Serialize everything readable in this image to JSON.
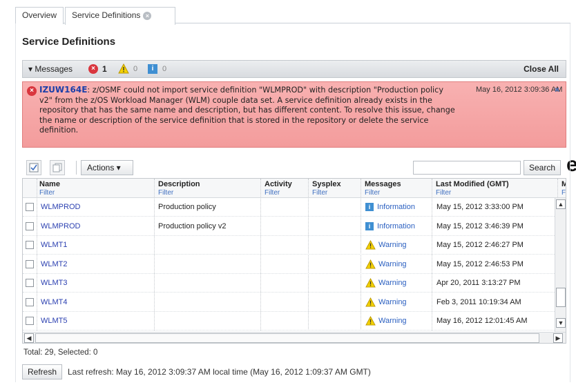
{
  "tabs": [
    {
      "label": "Overview"
    },
    {
      "label": "Service Definitions"
    }
  ],
  "page_title": "Service Definitions",
  "stray_text": "e",
  "messages_bar": {
    "toggle_label": "▾ Messages",
    "error_count": "1",
    "warning_count": "0",
    "info_count": "0",
    "close_all": "Close All"
  },
  "error_message": {
    "code": "IZUW164E",
    "text": ": z/OSMF could not import service definition \"WLMPROD\" with description \"Production policy v2\" from the z/OS Workload Manager (WLM) couple data set. A service definition already exists in the repository that has the same name and description, but has different content. To resolve this issue, change the name or description of the service definition that is stored in the repository or delete the service definition.",
    "date": "May 16, 2012 3:09:36 AM",
    "close": "×"
  },
  "toolbar": {
    "actions_label": "Actions ▾",
    "search_value": "",
    "search_button": "Search"
  },
  "table": {
    "columns": [
      {
        "label": "Name",
        "filter": "Filter"
      },
      {
        "label": "Description",
        "filter": "Filter"
      },
      {
        "label": "Activity",
        "filter": "Filter"
      },
      {
        "label": "Sysplex",
        "filter": "Filter"
      },
      {
        "label": "Messages",
        "filter": "Filter"
      },
      {
        "label": "Last Modified (GMT)",
        "filter": "Filter"
      },
      {
        "label": "M",
        "filter": "F"
      }
    ],
    "rows": [
      {
        "name": "WLMPROD",
        "description": "Production policy",
        "message": "Information",
        "message_type": "info",
        "modified": "May 15, 2012 3:33:00 PM"
      },
      {
        "name": "WLMPROD",
        "description": "Production policy v2",
        "message": "Information",
        "message_type": "info",
        "modified": "May 15, 2012 3:46:39 PM"
      },
      {
        "name": "WLMT1",
        "description": "",
        "message": "Warning",
        "message_type": "warning",
        "modified": "May 15, 2012 2:46:27 PM"
      },
      {
        "name": "WLMT2",
        "description": "",
        "message": "Warning",
        "message_type": "warning",
        "modified": "May 15, 2012 2:46:53 PM"
      },
      {
        "name": "WLMT3",
        "description": "",
        "message": "Warning",
        "message_type": "warning",
        "modified": "Apr 20, 2011 3:13:27 PM"
      },
      {
        "name": "WLMT4",
        "description": "",
        "message": "Warning",
        "message_type": "warning",
        "modified": "Feb 3, 2011 10:19:34 AM"
      },
      {
        "name": "WLMT5",
        "description": "",
        "message": "Warning",
        "message_type": "warning",
        "modified": "May 16, 2012 12:01:45 AM"
      }
    ]
  },
  "status": {
    "total": "Total: 29, Selected: 0"
  },
  "footer": {
    "refresh_button": "Refresh",
    "last_refresh": "Last refresh: May 16, 2012 3:09:37 AM local time (May 16, 2012 1:09:37 AM GMT)"
  },
  "colors": {
    "error": "#d9363e",
    "error_bg": "#f39c9c",
    "info": "#3f8fd2",
    "warning": "#f5c400",
    "link": "#2a3fb0"
  }
}
